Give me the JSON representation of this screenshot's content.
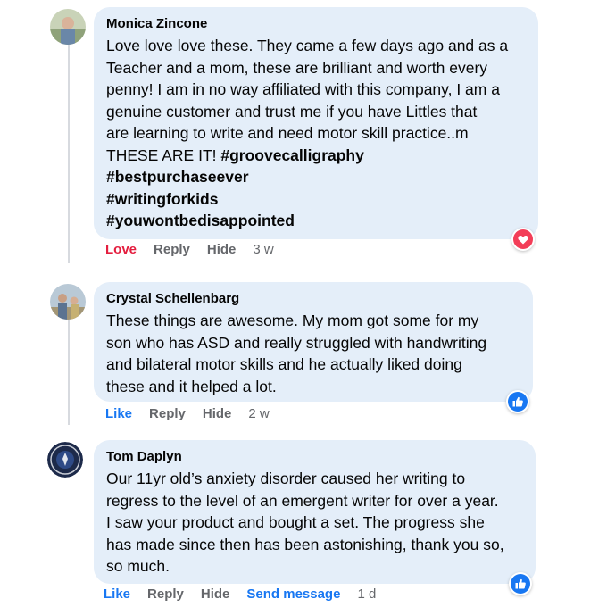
{
  "comments": [
    {
      "author": "Monica Zincone",
      "lines": [
        "Love love love these. They came a few days ago and as a",
        "Teacher and a mom, these are brilliant and worth every",
        "penny! I am in no way affiliated with this company, I am a",
        "genuine customer and trust me if you have Littles that",
        "are learning to write and need motor skill practice..m"
      ],
      "line6_text": "THESE ARE IT! ",
      "line6_tag": "#groovecalligraphy",
      "hashtags": [
        "#bestpurchaseever",
        "#writingforkids",
        "#youwontbedisappointed"
      ],
      "actions": [
        "Love",
        "Reply",
        "Hide"
      ],
      "time": "3 w",
      "reaction": "heart-reaction",
      "reaction_color": "#f33e58"
    },
    {
      "author": "Crystal Schellenbarg",
      "lines": [
        "These things are awesome. My mom got some for my",
        "son who has ASD and really struggled with handwriting",
        "and bilateral motor skills and he actually liked doing",
        "these and it helped a lot."
      ],
      "actions": [
        "Like",
        "Reply",
        "Hide"
      ],
      "time": "2 w",
      "reaction": "thumbs-up-reaction",
      "reaction_color": "#1877f2"
    },
    {
      "author": "Tom Daplyn",
      "lines": [
        "Our 11yr old’s anxiety disorder caused her writing to",
        "regress to the level of an emergent writer for over a year.",
        "I saw your product and bought a set. The progress she",
        "has made since then has been astonishing, thank you so,",
        "so much."
      ],
      "actions": [
        "Like",
        "Reply",
        "Hide",
        "Send message"
      ],
      "time": "1 d",
      "reaction": "thumbs-up-reaction",
      "reaction_color": "#1877f2"
    }
  ]
}
